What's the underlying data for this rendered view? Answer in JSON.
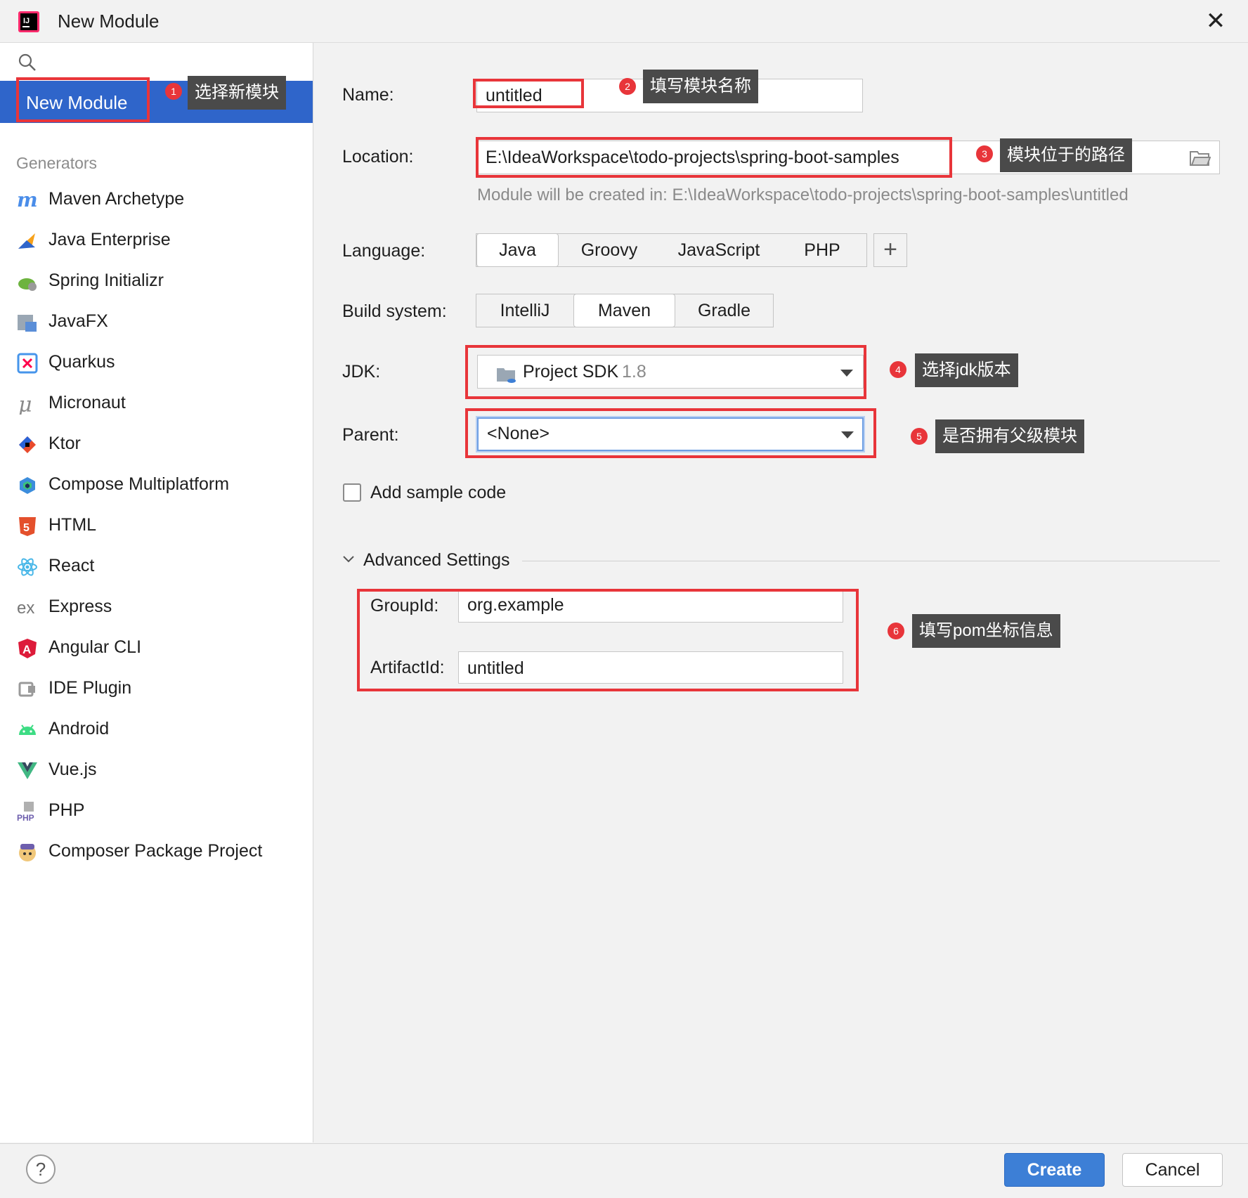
{
  "window": {
    "title": "New Module",
    "close_glyph": "✕"
  },
  "sidebar": {
    "selected_item": "New Module",
    "generators_header": "Generators",
    "generators": [
      {
        "label": "Maven Archetype",
        "icon": "maven-icon"
      },
      {
        "label": "Java Enterprise",
        "icon": "java-enterprise-icon"
      },
      {
        "label": "Spring Initializr",
        "icon": "spring-icon"
      },
      {
        "label": "JavaFX",
        "icon": "javafx-icon"
      },
      {
        "label": "Quarkus",
        "icon": "quarkus-icon"
      },
      {
        "label": "Micronaut",
        "icon": "micronaut-icon"
      },
      {
        "label": "Ktor",
        "icon": "ktor-icon"
      },
      {
        "label": "Compose Multiplatform",
        "icon": "compose-icon"
      },
      {
        "label": "HTML",
        "icon": "html5-icon"
      },
      {
        "label": "React",
        "icon": "react-icon"
      },
      {
        "label": "Express",
        "icon": "express-icon"
      },
      {
        "label": "Angular CLI",
        "icon": "angular-icon"
      },
      {
        "label": "IDE Plugin",
        "icon": "ide-plugin-icon"
      },
      {
        "label": "Android",
        "icon": "android-icon"
      },
      {
        "label": "Vue.js",
        "icon": "vue-icon"
      },
      {
        "label": "PHP",
        "icon": "php-icon"
      },
      {
        "label": "Composer Package Project",
        "icon": "composer-icon"
      }
    ]
  },
  "form": {
    "name_label": "Name:",
    "name_value": "untitled",
    "location_label": "Location:",
    "location_value": "E:\\IdeaWorkspace\\todo-projects\\spring-boot-samples",
    "location_hint": "Module will be created in: E:\\IdeaWorkspace\\todo-projects\\spring-boot-samples\\untitled",
    "language_label": "Language:",
    "languages": [
      "Java",
      "Groovy",
      "JavaScript",
      "PHP"
    ],
    "language_selected": "Java",
    "add_glyph": "+",
    "build_label": "Build system:",
    "build_systems": [
      "IntelliJ",
      "Maven",
      "Gradle"
    ],
    "build_selected": "Maven",
    "jdk_label": "JDK:",
    "jdk_value": "Project SDK",
    "jdk_version": "1.8",
    "parent_label": "Parent:",
    "parent_value": "<None>",
    "sample_code_label": "Add sample code",
    "sample_code_checked": false,
    "advanced_label": "Advanced Settings",
    "groupid_label": "GroupId:",
    "groupid_value": "org.example",
    "artifactid_label": "ArtifactId:",
    "artifactid_value": "untitled"
  },
  "annotations": [
    {
      "num": "1",
      "text": "选择新模块"
    },
    {
      "num": "2",
      "text": "填写模块名称"
    },
    {
      "num": "3",
      "text": "模块位于的路径"
    },
    {
      "num": "4",
      "text": "选择jdk版本"
    },
    {
      "num": "5",
      "text": "是否拥有父级模块"
    },
    {
      "num": "6",
      "text": "填写pom坐标信息"
    }
  ],
  "footer": {
    "help_glyph": "?",
    "create_label": "Create",
    "cancel_label": "Cancel"
  },
  "colors": {
    "accent": "#2f65ca",
    "annotation_red": "#e8353a",
    "tooltip_bg": "#4a4a4a",
    "create_button": "#3d7fd6"
  }
}
